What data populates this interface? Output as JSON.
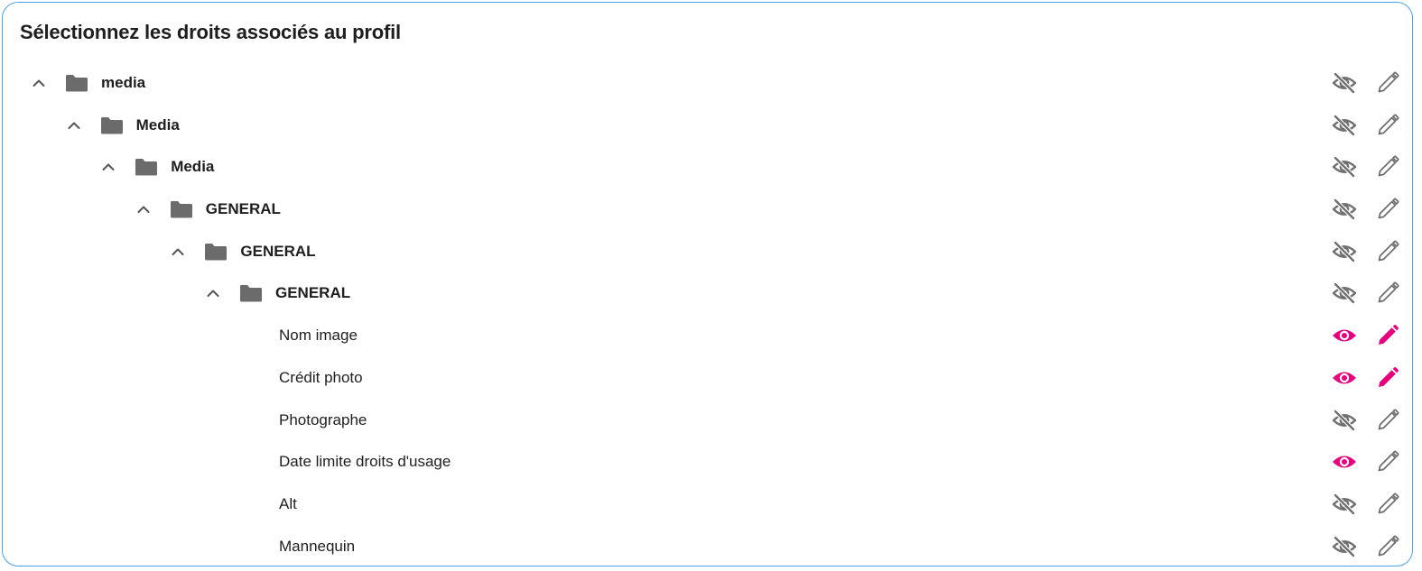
{
  "panel": {
    "title": "Sélectionnez les droits associés au profil"
  },
  "colors": {
    "accent": "#e6007e",
    "inactive": "#707070",
    "border": "#4aa3e8",
    "folder": "#6b6b6b"
  },
  "rows": [
    {
      "label": "media",
      "type": "folder",
      "level": 0,
      "expanded": true,
      "view": false,
      "edit": false
    },
    {
      "label": "Media",
      "type": "folder",
      "level": 1,
      "expanded": true,
      "view": false,
      "edit": false
    },
    {
      "label": "Media",
      "type": "folder",
      "level": 2,
      "expanded": true,
      "view": false,
      "edit": false
    },
    {
      "label": "GENERAL",
      "type": "folder",
      "level": 3,
      "expanded": true,
      "view": false,
      "edit": false
    },
    {
      "label": "GENERAL",
      "type": "folder",
      "level": 4,
      "expanded": true,
      "view": false,
      "edit": false
    },
    {
      "label": "GENERAL",
      "type": "folder",
      "level": 5,
      "expanded": true,
      "view": false,
      "edit": false
    },
    {
      "label": "Nom image",
      "type": "field",
      "level": 6,
      "view": true,
      "edit": true
    },
    {
      "label": "Crédit photo",
      "type": "field",
      "level": 6,
      "view": true,
      "edit": true
    },
    {
      "label": "Photographe",
      "type": "field",
      "level": 6,
      "view": false,
      "edit": false
    },
    {
      "label": "Date limite droits d'usage",
      "type": "field",
      "level": 6,
      "view": true,
      "edit": false
    },
    {
      "label": "Alt",
      "type": "field",
      "level": 6,
      "view": false,
      "edit": false
    },
    {
      "label": "Mannequin",
      "type": "field",
      "level": 6,
      "view": false,
      "edit": false
    }
  ]
}
